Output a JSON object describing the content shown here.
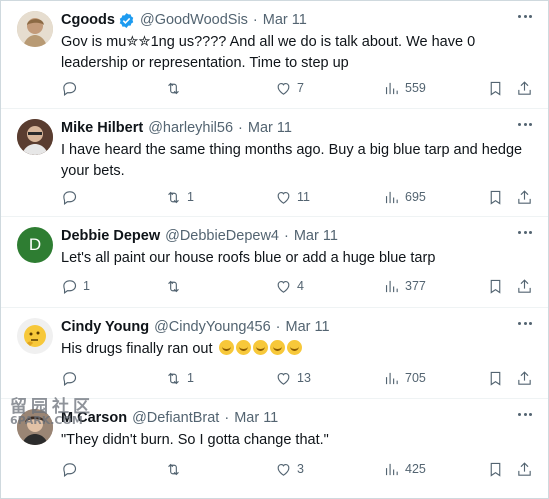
{
  "tweets": [
    {
      "name": "Cgoods",
      "verified": true,
      "handle": "@GoodWoodSis",
      "date": "Mar 11",
      "text": "Gov is mu✮✮1ng us???? And all we do is talk about. We have 0 leadership or representation. Time to step up",
      "reply_count": "",
      "retweet_count": "",
      "like_count": "7",
      "view_count": "559",
      "avatar_color": "#c9b59a"
    },
    {
      "name": "Mike Hilbert",
      "verified": false,
      "handle": "@harleyhil56",
      "date": "Mar 11",
      "text": "I have heard the same thing months ago. Buy a big blue tarp and hedge your bets.",
      "reply_count": "",
      "retweet_count": "1",
      "like_count": "11",
      "view_count": "695",
      "avatar_color": "#6b4a3a"
    },
    {
      "name": "Debbie Depew",
      "verified": false,
      "handle": "@DebbieDepew4",
      "date": "Mar 11",
      "text": "Let's all paint our house roofs blue or add a huge blue tarp",
      "reply_count": "1",
      "retweet_count": "",
      "like_count": "4",
      "view_count": "377",
      "avatar_letter": "D",
      "avatar_color": "#2e7d32"
    },
    {
      "name": "Cindy Young",
      "verified": false,
      "handle": "@CindyYoung456",
      "date": "Mar 11",
      "text": "His drugs finally ran out",
      "reply_count": "",
      "retweet_count": "1",
      "like_count": "13",
      "view_count": "705",
      "avatar_color": "#f0f0f0"
    },
    {
      "name": "M Carson",
      "verified": false,
      "handle": "@DefiantBrat",
      "date": "Mar 11",
      "text": "\"They didn't burn. So I gotta change that.\"",
      "reply_count": "",
      "retweet_count": "",
      "like_count": "3",
      "view_count": "425",
      "avatar_color": "#8a6f5c"
    }
  ],
  "watermark": {
    "line1": "留园社区",
    "line2": "6PARK.COM"
  },
  "colors": {
    "verified_blue": "#1d9bf0",
    "muted": "#536471",
    "text": "#0f1419"
  }
}
